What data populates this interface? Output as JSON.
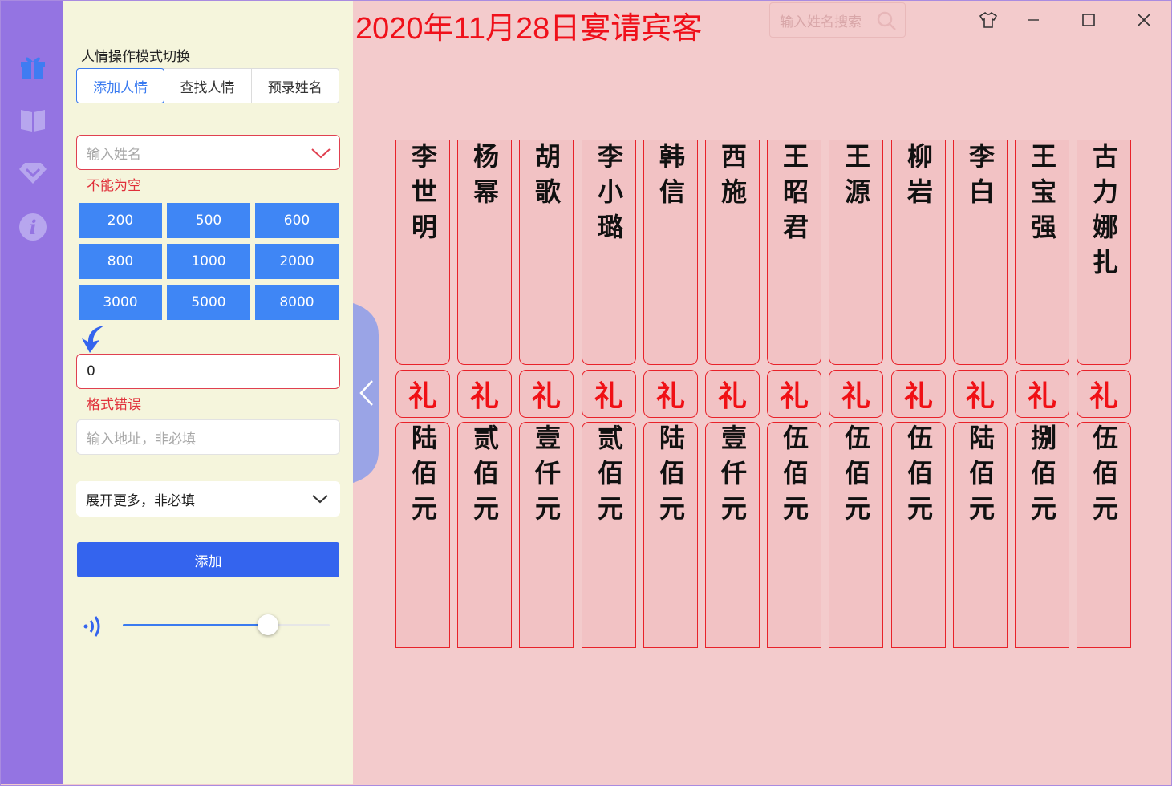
{
  "header": {
    "title": "2020年11月28日宴请宾客",
    "search_placeholder": "输入姓名搜索"
  },
  "sidebar": {
    "icons": [
      "gift-icon",
      "book-icon",
      "diamond-icon",
      "info-icon"
    ]
  },
  "panel": {
    "mode_label": "人情操作模式切换",
    "tabs": [
      {
        "label": "添加人情",
        "active": true
      },
      {
        "label": "查找人情",
        "active": false
      },
      {
        "label": "预录姓名",
        "active": false
      }
    ],
    "name_placeholder": "输入姓名",
    "name_error": "不能为空",
    "amounts": [
      "200",
      "500",
      "600",
      "800",
      "1000",
      "2000",
      "3000",
      "5000",
      "8000"
    ],
    "amount_value": "0",
    "amount_error": "格式错误",
    "address_placeholder": "输入地址，非必填",
    "more_label": "展开更多，非必填",
    "add_label": "添加",
    "volume": 0.7
  },
  "gifts": {
    "li_char": "礼",
    "entries": [
      {
        "name": "李世明",
        "amount": "陆佰元"
      },
      {
        "name": "杨幂",
        "amount": "贰佰元"
      },
      {
        "name": "胡歌",
        "amount": "壹仟元"
      },
      {
        "name": "李小璐",
        "amount": "贰佰元"
      },
      {
        "name": "韩信",
        "amount": "陆佰元"
      },
      {
        "name": "西施",
        "amount": "壹仟元"
      },
      {
        "name": "王昭君",
        "amount": "伍佰元"
      },
      {
        "name": "王源",
        "amount": "伍佰元"
      },
      {
        "name": "柳岩",
        "amount": "伍佰元"
      },
      {
        "name": "李白",
        "amount": "陆佰元"
      },
      {
        "name": "王宝强",
        "amount": "捌佰元"
      },
      {
        "name": "古力娜扎",
        "amount": "伍佰元"
      }
    ]
  },
  "colors": {
    "accent": "#3a7bf0",
    "title_red": "#f0101a",
    "sidebar": "#9474e2",
    "panel_bg": "#f5f5dc",
    "page_bg": "#f3cbcc"
  }
}
